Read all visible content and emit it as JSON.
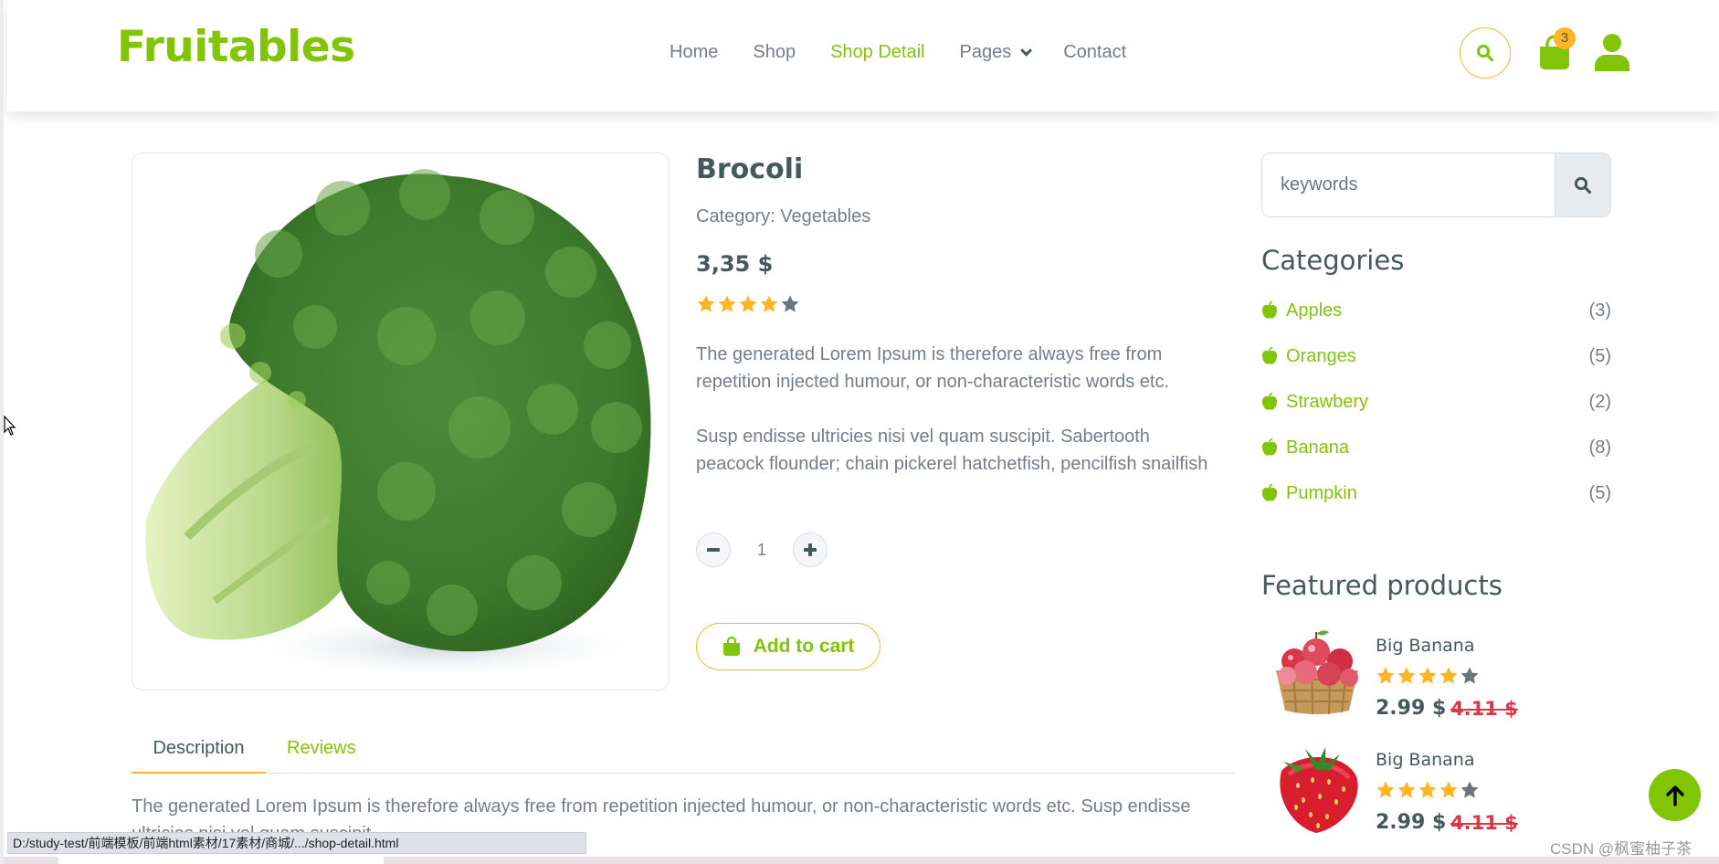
{
  "header": {
    "logo": "Fruitables",
    "nav": [
      {
        "label": "Home",
        "active": false
      },
      {
        "label": "Shop",
        "active": false
      },
      {
        "label": "Shop Detail",
        "active": true
      },
      {
        "label": "Pages",
        "active": false,
        "dropdown": true
      },
      {
        "label": "Contact",
        "active": false
      }
    ],
    "cart_count": "3",
    "icons": [
      "search-icon",
      "shopping-bag-icon",
      "user-icon"
    ]
  },
  "product": {
    "title": "Brocoli",
    "category": "Category: Vegetables",
    "price": "3,35 $",
    "rating": 4,
    "rating_max": 5,
    "description_1": "The generated Lorem Ipsum is therefore always free from repetition injected humour, or non-characteristic words etc.",
    "description_2": "Susp endisse ultricies nisi vel quam suscipit. Sabertooth peacock flounder; chain pickerel hatchetfish, pencilfish snailfish",
    "quantity": "1",
    "minus_label": "−",
    "plus_label": "+",
    "add_to_cart": "Add to cart"
  },
  "tabs": {
    "items": [
      {
        "label": "Description",
        "active": true
      },
      {
        "label": "Reviews",
        "active": false
      }
    ],
    "content": "The generated Lorem Ipsum is therefore always free from repetition injected humour, or non-characteristic words etc. Susp endisse ultricies nisi vel quam suscipit"
  },
  "sidebar": {
    "search_placeholder": "keywords",
    "categories_title": "Categories",
    "categories": [
      {
        "name": "Apples",
        "count": "(3)"
      },
      {
        "name": "Oranges",
        "count": "(5)"
      },
      {
        "name": "Strawbery",
        "count": "(2)"
      },
      {
        "name": "Banana",
        "count": "(8)"
      },
      {
        "name": "Pumpkin",
        "count": "(5)"
      }
    ],
    "featured_title": "Featured products",
    "featured": [
      {
        "name": "Big Banana",
        "rating": 4,
        "price": "2.99 $",
        "old_price": "4.11 $",
        "image": "apple-basket"
      },
      {
        "name": "Big Banana",
        "rating": 4,
        "price": "2.99 $",
        "old_price": "4.11 $",
        "image": "strawberry"
      }
    ]
  },
  "browser": {
    "status_url": "D:/study-test/前端模板/前端html素材/17素材/商城/.../shop-detail.html",
    "watermark": "CSDN @枫蜜柚子茶"
  },
  "colors": {
    "brand_green": "#81c408",
    "accent_orange": "#ffb524",
    "text_dark": "#45595b",
    "text_muted": "#747d88",
    "sale_red": "#dc3545"
  }
}
